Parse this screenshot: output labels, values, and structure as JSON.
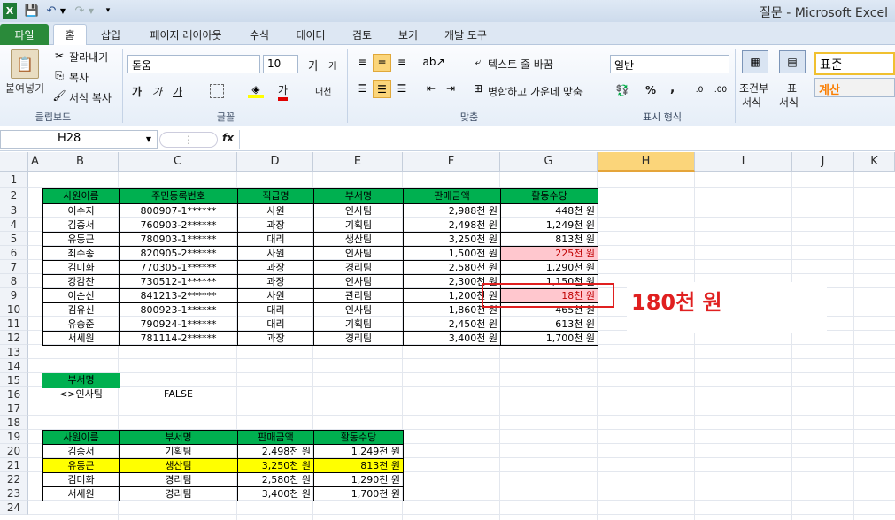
{
  "window": {
    "title": "질문 - Microsoft Excel"
  },
  "tabs": [
    "파일",
    "홈",
    "삽입",
    "페이지 레이아웃",
    "수식",
    "데이터",
    "검토",
    "보기",
    "개발 도구"
  ],
  "ribbon": {
    "clipboard": {
      "paste": "붙여넣기",
      "cut": "잘라내기",
      "copy": "복사",
      "format_painter": "서식 복사",
      "label": "클립보드"
    },
    "font": {
      "name": "돋움",
      "size": "10",
      "grow": "가",
      "shrink": "가",
      "bold": "가",
      "italic": "가",
      "underline": "가",
      "phonetic": "내천",
      "label": "글꼴"
    },
    "align": {
      "wrap": "텍스트 줄 바꿈",
      "merge": "병합하고 가운데 맞춤",
      "label": "맞춤"
    },
    "number": {
      "format": "일반",
      "percent": "%",
      "comma": ",",
      "label": "표시 형식"
    },
    "styles": {
      "cond": "조건부",
      "cond2": "서식",
      "table": "표",
      "table2": "서식",
      "normal": "표준",
      "calc": "계산"
    }
  },
  "formula_bar": {
    "name_box": "H28",
    "fx": "fx",
    "value": ""
  },
  "columns": [
    "A",
    "B",
    "C",
    "D",
    "E",
    "F",
    "G",
    "H",
    "I",
    "J",
    "K"
  ],
  "rows": [
    "1",
    "2",
    "3",
    "4",
    "5",
    "6",
    "7",
    "8",
    "9",
    "10",
    "11",
    "12",
    "13",
    "14",
    "15",
    "16",
    "17",
    "18",
    "19",
    "20",
    "21",
    "22",
    "23",
    "24"
  ],
  "table1": {
    "headers": [
      "사원이름",
      "주민등록번호",
      "직급명",
      "부서명",
      "판매금액",
      "활동수당"
    ],
    "rows": [
      [
        "이수지",
        "800907-1******",
        "사원",
        "인사팀",
        "2,988천 원",
        "448천 원"
      ],
      [
        "김종서",
        "760903-2******",
        "과장",
        "기획팀",
        "2,498천 원",
        "1,249천 원"
      ],
      [
        "유동근",
        "780903-1******",
        "대리",
        "생산팀",
        "3,250천 원",
        "813천 원"
      ],
      [
        "최수종",
        "820905-2******",
        "사원",
        "인사팀",
        "1,500천 원",
        "225천 원"
      ],
      [
        "김미화",
        "770305-1******",
        "과장",
        "경리팀",
        "2,580천 원",
        "1,290천 원"
      ],
      [
        "강감찬",
        "730512-1******",
        "과장",
        "인사팀",
        "2,300천 원",
        "1,150천 원"
      ],
      [
        "이순신",
        "841213-2******",
        "사원",
        "관리팀",
        "1,200천 원",
        "18천 원"
      ],
      [
        "김유신",
        "800923-1******",
        "대리",
        "인사팀",
        "1,860천 원",
        "465천 원"
      ],
      [
        "유승준",
        "790924-1******",
        "대리",
        "기획팀",
        "2,450천 원",
        "613천 원"
      ],
      [
        "서세원",
        "781114-2******",
        "과장",
        "경리팀",
        "3,400천 원",
        "1,700천 원"
      ]
    ]
  },
  "criteria": {
    "header": "부서명",
    "value": "<>인사팀",
    "result": "FALSE"
  },
  "table2": {
    "headers": [
      "사원이름",
      "부서명",
      "판매금액",
      "활동수당"
    ],
    "rows": [
      [
        "김종서",
        "기획팀",
        "2,498천 원",
        "1,249천 원"
      ],
      [
        "유동근",
        "생산팀",
        "3,250천 원",
        "813천 원"
      ],
      [
        "김미화",
        "경리팀",
        "2,580천 원",
        "1,290천 원"
      ],
      [
        "서세원",
        "경리팀",
        "3,400천 원",
        "1,700천 원"
      ]
    ]
  },
  "annotation": "180천 원",
  "colors": {
    "header_green": "#00b050",
    "highlight_pink": "#ffc7ce",
    "highlight_yellow": "#ffff00",
    "callout_red": "#e02020"
  }
}
